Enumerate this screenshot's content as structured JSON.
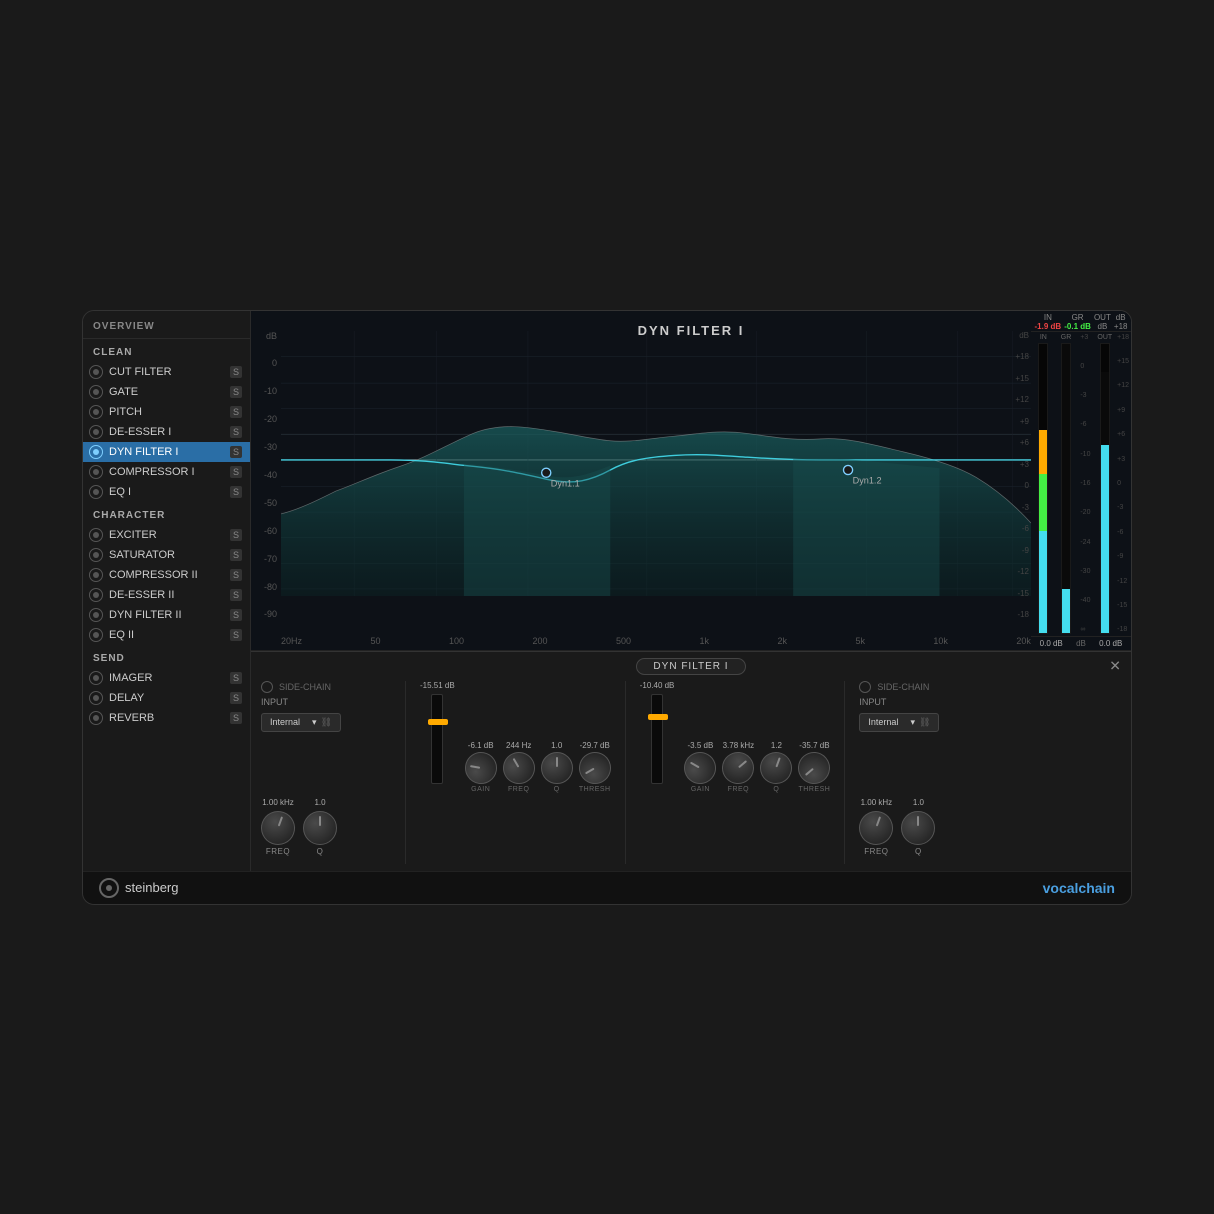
{
  "window": {
    "title": "VocalChain - Steinberg"
  },
  "sidebar": {
    "overview_label": "OVERVIEW",
    "sections": [
      {
        "label": "CLEAN",
        "items": [
          {
            "id": "cut-filter",
            "label": "CUT FILTER",
            "s": "S",
            "active": false
          },
          {
            "id": "gate",
            "label": "GATE",
            "s": "S",
            "active": false
          },
          {
            "id": "pitch",
            "label": "PITCH",
            "s": "S",
            "active": false
          },
          {
            "id": "de-esser-i",
            "label": "DE-ESSER I",
            "s": "S",
            "active": false
          },
          {
            "id": "dyn-filter-i",
            "label": "DYN FILTER I",
            "s": "S",
            "active": true
          },
          {
            "id": "compressor-i",
            "label": "COMPRESSOR I",
            "s": "S",
            "active": false
          },
          {
            "id": "eq-i",
            "label": "EQ I",
            "s": "S",
            "active": false
          }
        ]
      },
      {
        "label": "CHARACTER",
        "items": [
          {
            "id": "exciter",
            "label": "EXCITER",
            "s": "S",
            "active": false
          },
          {
            "id": "saturator",
            "label": "SATURATOR",
            "s": "S",
            "active": false
          },
          {
            "id": "compressor-ii",
            "label": "COMPRESSOR II",
            "s": "S",
            "active": false
          },
          {
            "id": "de-esser-ii",
            "label": "DE-ESSER II",
            "s": "S",
            "active": false
          },
          {
            "id": "dyn-filter-ii",
            "label": "DYN FILTER II",
            "s": "S",
            "active": false
          },
          {
            "id": "eq-ii",
            "label": "EQ II",
            "s": "S",
            "active": false
          }
        ]
      },
      {
        "label": "SEND",
        "items": [
          {
            "id": "imager",
            "label": "IMAGER",
            "s": "S",
            "active": false
          },
          {
            "id": "delay",
            "label": "DELAY",
            "s": "S",
            "active": false
          },
          {
            "id": "reverb",
            "label": "REVERB",
            "s": "S",
            "active": false
          }
        ]
      }
    ]
  },
  "spectrum": {
    "title": "DYN FILTER I",
    "db_labels": [
      "0",
      "-10",
      "-20",
      "-30",
      "-40",
      "-50",
      "-60",
      "-70",
      "-80",
      "-90"
    ],
    "freq_labels": [
      "20Hz",
      "50",
      "100",
      "200",
      "500",
      "1k",
      "2k",
      "5k",
      "10k",
      "20k"
    ],
    "dyn_points": [
      {
        "label": "Dyn1.1",
        "x": "35%",
        "y": "65%"
      },
      {
        "label": "Dyn1.2",
        "x": "67%",
        "y": "65%"
      }
    ]
  },
  "meters": {
    "in_label": "IN",
    "in_value": "-1.9 dB",
    "gr_label": "GR",
    "gr_value": "-0.1 dB",
    "out_label": "OUT",
    "db_scale": [
      "+18",
      "+15",
      "+12",
      "+9",
      "+6",
      "+3",
      "0",
      "-3",
      "-6",
      "-9",
      "-12",
      "-15",
      "-18"
    ],
    "bottom_in": "0.0 dB",
    "bottom_out": "0.0 dB"
  },
  "bottom_panel": {
    "title": "DYN FILTER I",
    "left_section": {
      "side_chain_label": "SIDE-CHAIN",
      "input_label": "INPUT",
      "input_value": "Internal",
      "freq_val": "1.00 kHz",
      "q_val": "1.0"
    },
    "dyn1": {
      "gain_val": "-6.1 dB",
      "freq_val": "244 Hz",
      "q_val": "1.0",
      "thresh_val": "-29.7 dB",
      "fader1_val": "-15.51 dB",
      "gain_label": "GAIN",
      "freq_label": "FREQ",
      "q_label": "Q",
      "thresh_label": "THRESH"
    },
    "dyn2": {
      "gain_val": "-3.5 dB",
      "freq_val": "3.78 kHz",
      "q_val": "1.2",
      "thresh_val": "-35.7 dB",
      "fader2_val": "-10.40 dB",
      "gain_label": "GAIN",
      "freq_label": "FREQ",
      "q_label": "Q",
      "thresh_label": "THRESH"
    },
    "right_section": {
      "side_chain_label": "SIDE-CHAIN",
      "input_label": "INPUT",
      "input_value": "Internal",
      "freq_val": "1.00 kHz",
      "q_val": "1.0"
    }
  },
  "footer": {
    "brand": "steinberg",
    "product": "vocal",
    "product2": "chain"
  }
}
